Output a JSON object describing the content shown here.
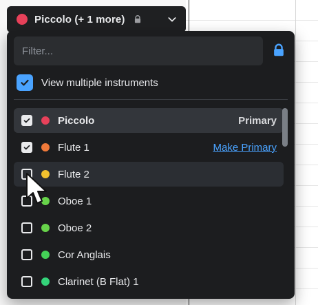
{
  "header": {
    "title": "Piccolo (+ 1 more)",
    "dot_color": "#e8415a",
    "lock_icon": "lock-icon",
    "chevron_icon": "chevron-down-icon"
  },
  "panel": {
    "filter": {
      "placeholder": "Filter...",
      "value": ""
    },
    "lock_color": "#4aa3ff",
    "view_multiple": {
      "label": "View multiple instruments",
      "checked": true
    },
    "instruments": [
      {
        "label": "Piccolo",
        "dot": "#e8415a",
        "checked": true,
        "state": "selected",
        "bold": true,
        "right_text": "Primary"
      },
      {
        "label": "Flute 1",
        "dot": "#f07a3a",
        "checked": true,
        "state": "normal",
        "bold": false,
        "link_text": "Make Primary"
      },
      {
        "label": "Flute 2",
        "dot": "#f2c12e",
        "checked": false,
        "state": "hover",
        "bold": false
      },
      {
        "label": "Oboe 1",
        "dot": "#67d34a",
        "checked": false,
        "state": "normal",
        "bold": false
      },
      {
        "label": "Oboe 2",
        "dot": "#67d34a",
        "checked": false,
        "state": "normal",
        "bold": false
      },
      {
        "label": "Cor Anglais",
        "dot": "#44d157",
        "checked": false,
        "state": "normal",
        "bold": false
      },
      {
        "label": "Clarinet (B Flat) 1",
        "dot": "#34d47a",
        "checked": false,
        "state": "normal",
        "bold": false
      }
    ]
  }
}
